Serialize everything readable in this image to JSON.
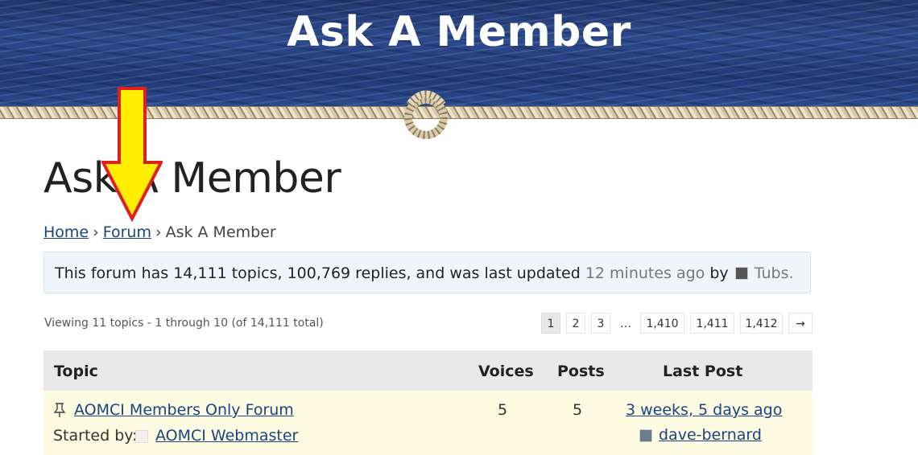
{
  "banner": {
    "title": "Ask A Member"
  },
  "page": {
    "title": "Ask A Member"
  },
  "breadcrumb": {
    "home": "Home",
    "forum": "Forum",
    "current": "Ask A Member",
    "separator": "›"
  },
  "info": {
    "text": "This forum has 14,111 topics, 100,769 replies, and was last updated",
    "updated": "12 minutes ago",
    "by": "by",
    "user": "Tubs."
  },
  "viewing": "Viewing 11 topics - 1 through 10 (of 14,111 total)",
  "pagination": {
    "pages": [
      "1",
      "2",
      "3",
      "…",
      "1,410",
      "1,411",
      "1,412",
      "→"
    ],
    "current": "1"
  },
  "table": {
    "headers": {
      "topic": "Topic",
      "voices": "Voices",
      "posts": "Posts",
      "last_post": "Last Post"
    },
    "rows": [
      {
        "title": "AOMCI Members Only Forum",
        "started_by_label": "Started by:",
        "author": "AOMCI Webmaster",
        "voices": "5",
        "posts": "5",
        "last_post_time": "3 weeks, 5 days ago",
        "last_post_user": "dave-bernard"
      }
    ]
  },
  "icons": {
    "pin": "pin-icon",
    "arrow": "down-arrow-annotation",
    "knot": "rope-knot-icon"
  },
  "colors": {
    "link": "#1a4480",
    "info_bg": "#eef6fc",
    "sticky_row_bg": "#fefbe3",
    "arrow_fill": "#ffee00",
    "arrow_stroke": "#e02020"
  }
}
